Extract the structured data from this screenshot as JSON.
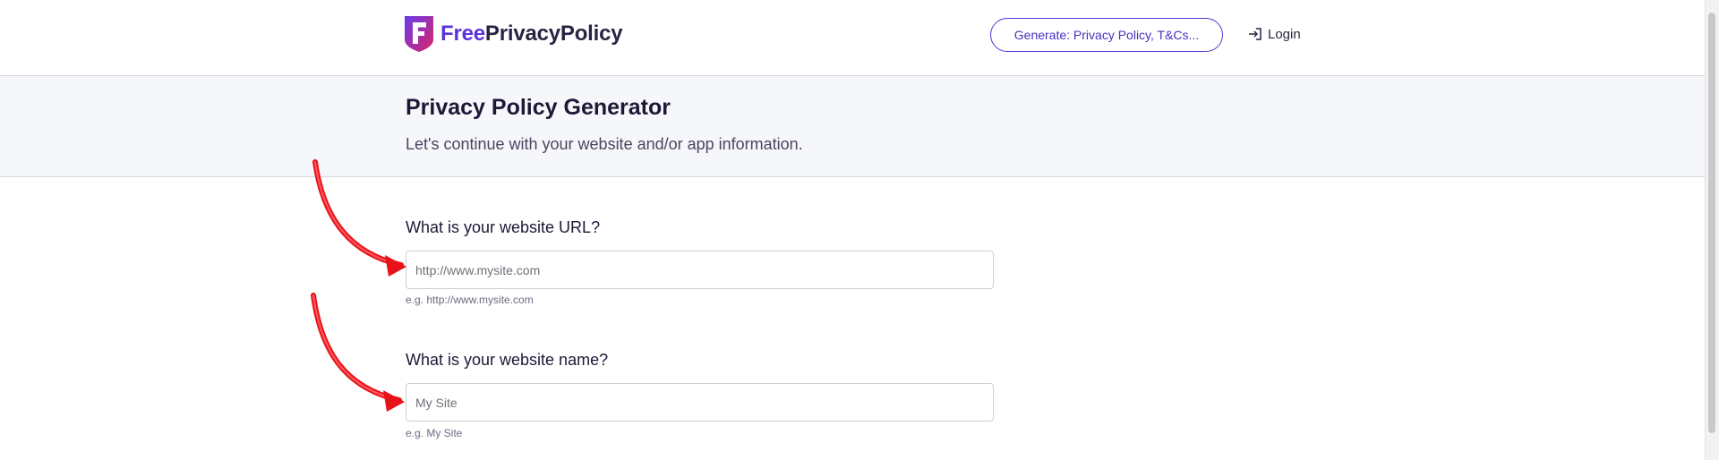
{
  "header": {
    "logo": {
      "free": "Free",
      "rest": "PrivacyPolicy"
    },
    "generate_button": "Generate: Privacy Policy, T&Cs...",
    "login": "Login"
  },
  "hero": {
    "title": "Privacy Policy Generator",
    "subtitle": "Let's continue with your website and/or app information."
  },
  "form": {
    "url": {
      "label": "What is your website URL?",
      "placeholder": "http://www.mysite.com",
      "value": "",
      "hint": "e.g. http://www.mysite.com"
    },
    "name": {
      "label": "What is your website name?",
      "placeholder": "My Site",
      "value": "",
      "hint": "e.g. My Site"
    }
  },
  "colors": {
    "brand": "#5b33d6",
    "logo_accent": "#d9246a",
    "annotation_arrow": "#e8121b",
    "hero_background": "#f6f7fa"
  },
  "icons": {
    "logo": "freeprivacypolicy-logo-icon",
    "login": "login-arrow-icon",
    "annotation": "red-arrow-icon"
  }
}
